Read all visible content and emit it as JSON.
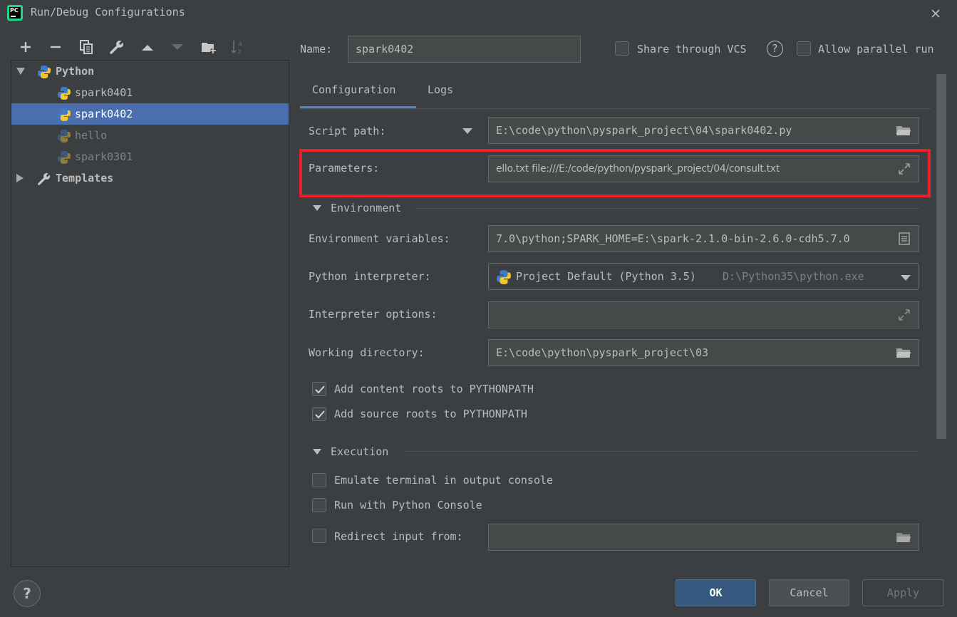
{
  "window": {
    "title": "Run/Debug Configurations",
    "app_icon_text": "PC"
  },
  "tree": {
    "root": {
      "label": "Python",
      "expanded": true
    },
    "items": [
      {
        "label": "spark0401",
        "selected": false,
        "dimmed": false
      },
      {
        "label": "spark0402",
        "selected": true,
        "dimmed": false
      },
      {
        "label": "hello",
        "selected": false,
        "dimmed": true
      },
      {
        "label": "spark0301",
        "selected": false,
        "dimmed": true
      }
    ],
    "templates": {
      "label": "Templates",
      "expanded": false
    }
  },
  "header": {
    "name_label": "Name:",
    "name_value": "spark0402",
    "share_vcs_label": "Share through VCS",
    "share_vcs_checked": false,
    "allow_parallel_label": "Allow parallel run",
    "allow_parallel_checked": false
  },
  "tabs": [
    {
      "label": "Configuration",
      "active": true
    },
    {
      "label": "Logs",
      "active": false
    }
  ],
  "form": {
    "script_path_label": "Script path:",
    "script_path_value": "E:\\code\\python\\pyspark_project\\04\\spark0402.py",
    "parameters_label": "Parameters:",
    "parameters_value": "ello.txt file:///E:/code/python/pyspark_project/04/consult.txt",
    "environment_section": "Environment",
    "env_vars_label": "Environment variables:",
    "env_vars_value": "7.0\\python;SPARK_HOME=E:\\spark-2.1.0-bin-2.6.0-cdh5.7.0",
    "interpreter_label": "Python interpreter:",
    "interpreter_value": "Project Default (Python 3.5)",
    "interpreter_path": "D:\\Python35\\python.exe",
    "interp_options_label": "Interpreter options:",
    "interp_options_value": "",
    "working_dir_label": "Working directory:",
    "working_dir_value": "E:\\code\\python\\pyspark_project\\03",
    "add_content_roots_label": "Add content roots to PYTHONPATH",
    "add_content_roots_checked": true,
    "add_source_roots_label": "Add source roots to PYTHONPATH",
    "add_source_roots_checked": true,
    "execution_section": "Execution",
    "emulate_terminal_label": "Emulate terminal in output console",
    "emulate_terminal_checked": false,
    "run_with_console_label": "Run with Python Console",
    "run_with_console_checked": false,
    "redirect_input_label": "Redirect input from:",
    "redirect_input_checked": false,
    "redirect_input_value": ""
  },
  "footer": {
    "help_label": "?",
    "ok_label": "OK",
    "cancel_label": "Cancel",
    "apply_label": "Apply"
  },
  "colors": {
    "background": "#3c3f41",
    "selection": "#4b6eaf",
    "highlight": "#e8202a",
    "tab_underline": "#4a88c7",
    "primary_button": "#365880"
  }
}
